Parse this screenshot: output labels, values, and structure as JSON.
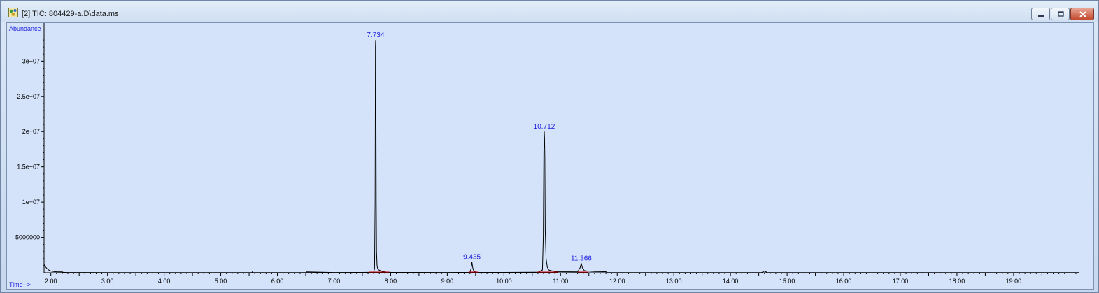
{
  "window": {
    "title": "[2] TIC: 804429-a.D\\data.ms",
    "controls": [
      "minimize",
      "restore",
      "close"
    ]
  },
  "colors": {
    "plot_background": "#d4e3fa",
    "trace": "#000000",
    "peak_label": "#1a1adb",
    "axis_label": "#1a1adb",
    "baseline_marker": "#cc0000"
  },
  "chart_data": {
    "type": "line",
    "title": "",
    "xlabel": "Time-->",
    "ylabel": "Abundance",
    "xlim": [
      1.88,
      20.15
    ],
    "ylim": [
      0,
      34000000
    ],
    "x_ticks": [
      2.0,
      3.0,
      4.0,
      5.0,
      6.0,
      7.0,
      8.0,
      9.0,
      10.0,
      11.0,
      12.0,
      13.0,
      14.0,
      15.0,
      16.0,
      17.0,
      18.0,
      19.0
    ],
    "x_tick_labels": [
      "2.00",
      "3.00",
      "4.00",
      "5.00",
      "6.00",
      "7.00",
      "8.00",
      "9.00",
      "10.00",
      "11.00",
      "12.00",
      "13.00",
      "14.00",
      "15.00",
      "16.00",
      "17.00",
      "18.00",
      "19.00"
    ],
    "y_ticks": [
      5000000,
      10000000,
      15000000,
      20000000,
      25000000,
      30000000
    ],
    "y_tick_labels": [
      "5000000",
      "1e+07",
      "1.5e+07",
      "2e+07",
      "2.5e+07",
      "3e+07"
    ],
    "peaks": [
      {
        "label": "7.734",
        "rt": 7.734,
        "abundance": 33000000
      },
      {
        "label": "9.435",
        "rt": 9.435,
        "abundance": 1550000
      },
      {
        "label": "10.712",
        "rt": 10.712,
        "abundance": 20000000
      },
      {
        "label": "11.366",
        "rt": 11.366,
        "abundance": 1350000
      }
    ],
    "series": [
      {
        "x": [
          1.88,
          1.9,
          1.93,
          1.96,
          2.0,
          2.05,
          2.1,
          2.2,
          2.22,
          2.3,
          3.0,
          4.0,
          5.0,
          5.55,
          5.56,
          5.57,
          6.0,
          6.5,
          6.51,
          7.0,
          7.5,
          7.7,
          7.715,
          7.725,
          7.732,
          7.735,
          7.74,
          7.745,
          7.75,
          7.76,
          7.77,
          7.79,
          7.82,
          7.85,
          7.9,
          8.0,
          9.0,
          9.4,
          9.42,
          9.435,
          9.45,
          9.47,
          9.52,
          10.0,
          10.6,
          10.68,
          10.695,
          10.705,
          10.712,
          10.717,
          10.722,
          10.73,
          10.745,
          10.765,
          10.79,
          10.83,
          10.9,
          11.0,
          11.3,
          11.345,
          11.366,
          11.385,
          11.42,
          11.5,
          11.6,
          11.8,
          11.82,
          12.0,
          13.0,
          14.0,
          14.55,
          14.6,
          14.65,
          15.0,
          16.0,
          17.0,
          18.0,
          19.0,
          20.15
        ],
        "y": [
          1200000,
          900000,
          600000,
          400000,
          250000,
          180000,
          140000,
          120000,
          60000,
          40000,
          30000,
          30000,
          30000,
          30000,
          150000,
          30000,
          30000,
          30000,
          120000,
          40000,
          50000,
          80000,
          600000,
          10000000,
          32000000,
          33000000,
          25000000,
          10000000,
          3000000,
          1000000,
          600000,
          400000,
          300000,
          200000,
          120000,
          60000,
          40000,
          60000,
          600000,
          1550000,
          700000,
          200000,
          60000,
          50000,
          80000,
          400000,
          5000000,
          17000000,
          20000000,
          19000000,
          16500000,
          6000000,
          2000000,
          800000,
          400000,
          300000,
          200000,
          150000,
          120000,
          700000,
          1350000,
          700000,
          300000,
          220000,
          180000,
          150000,
          40000,
          30000,
          30000,
          30000,
          30000,
          250000,
          30000,
          30000,
          30000,
          30000,
          30000,
          30000,
          30000
        ]
      }
    ]
  }
}
